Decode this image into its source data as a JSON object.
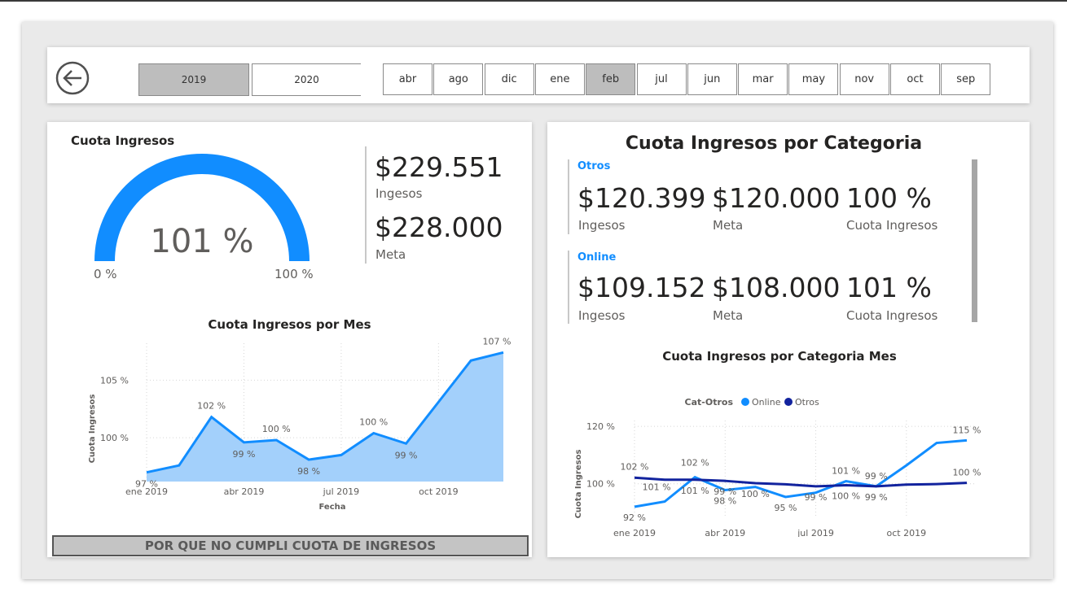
{
  "slicers": {
    "years": [
      {
        "label": "2019",
        "selected": true
      },
      {
        "label": "2020",
        "selected": false
      }
    ],
    "months": [
      {
        "label": "abr",
        "selected": false
      },
      {
        "label": "ago",
        "selected": false
      },
      {
        "label": "dic",
        "selected": false
      },
      {
        "label": "ene",
        "selected": false
      },
      {
        "label": "feb",
        "selected": true
      },
      {
        "label": "jul",
        "selected": false
      },
      {
        "label": "jun",
        "selected": false
      },
      {
        "label": "mar",
        "selected": false
      },
      {
        "label": "may",
        "selected": false
      },
      {
        "label": "nov",
        "selected": false
      },
      {
        "label": "oct",
        "selected": false
      },
      {
        "label": "sep",
        "selected": false
      }
    ]
  },
  "gauge": {
    "title": "Cuota Ingresos",
    "value_label": "101 %",
    "min_label": "0 %",
    "max_label": "100 %",
    "value": 101,
    "min": 0,
    "max": 100,
    "color": "#118dff"
  },
  "totals": {
    "ingresos_value": "$229.551",
    "ingresos_label": "Ingesos",
    "meta_value": "$228.000",
    "meta_label": "Meta"
  },
  "categories_card": {
    "title": "Cuota Ingresos por Categoria",
    "items": [
      {
        "name": "Otros",
        "ingresos": "$120.399",
        "ingresos_label": "Ingesos",
        "meta": "$120.000",
        "meta_label": "Meta",
        "cuota": "100 %",
        "cuota_label": "Cuota Ingresos"
      },
      {
        "name": "Online",
        "ingresos": "$109.152",
        "ingresos_label": "Ingesos",
        "meta": "$108.000",
        "meta_label": "Meta",
        "cuota": "101 %",
        "cuota_label": "Cuota Ingresos"
      }
    ]
  },
  "bottom_button": {
    "label": "POR QUE NO CUMPLI CUOTA DE INGRESOS"
  },
  "chart_data": [
    {
      "type": "area",
      "title": "Cuota Ingresos por Mes",
      "xlabel": "Fecha",
      "ylabel": "Cuota Ingresos",
      "x": [
        "2019-01",
        "2019-02",
        "2019-03",
        "2019-04",
        "2019-05",
        "2019-06",
        "2019-07",
        "2019-08",
        "2019-09",
        "2019-10",
        "2019-11",
        "2019-12"
      ],
      "x_ticks": [
        "ene 2019",
        "abr 2019",
        "jul 2019",
        "oct 2019"
      ],
      "y_ticks": [
        "100 %",
        "105 %"
      ],
      "ylim": [
        96.2,
        108.2
      ],
      "values": [
        97,
        97.6,
        101.8,
        99.6,
        99.8,
        98.1,
        98.5,
        100.4,
        99.5,
        103.1,
        106.7,
        107.4
      ],
      "data_labels": [
        {
          "i": 0,
          "text": "97 %"
        },
        {
          "i": 2,
          "text": "102 %"
        },
        {
          "i": 3,
          "text": "99 %"
        },
        {
          "i": 4,
          "text": "100 %"
        },
        {
          "i": 5,
          "text": "98 %"
        },
        {
          "i": 7,
          "text": "100 %"
        },
        {
          "i": 8,
          "text": "99 %"
        },
        {
          "i": 11,
          "text": "107 %"
        }
      ],
      "colors": {
        "line": "#118dff",
        "fill": "#a3d0fb"
      }
    },
    {
      "type": "line",
      "title": "Cuota Ingresos por Categoria Mes",
      "xlabel": "Fecha",
      "ylabel": "Cuota Ingresos",
      "legend_title": "Cat-Otros",
      "x": [
        "2019-01",
        "2019-02",
        "2019-03",
        "2019-04",
        "2019-05",
        "2019-06",
        "2019-07",
        "2019-08",
        "2019-09",
        "2019-10",
        "2019-11",
        "2019-12"
      ],
      "x_ticks": [
        "ene 2019",
        "abr 2019",
        "jul 2019",
        "oct 2019"
      ],
      "y_ticks": [
        "100 %",
        "120 %"
      ],
      "ylim": [
        88.6,
        122
      ],
      "series": [
        {
          "name": "Online",
          "color": "#118dff",
          "values": [
            92,
            93.8,
            102.3,
            97.8,
            98.9,
            95.4,
            96.9,
            100.9,
            99.1,
            106.4,
            114.2,
            115.1
          ],
          "labels": [
            {
              "i": 0,
              "text": "92 %"
            },
            {
              "i": 1,
              "text": "101 %"
            },
            {
              "i": 2,
              "text": "102 %"
            },
            {
              "i": 3,
              "text": "98 %"
            },
            {
              "i": 5,
              "text": "95 %"
            },
            {
              "i": 7,
              "text": "101 %"
            },
            {
              "i": 8,
              "text": "99 %"
            },
            {
              "i": 11,
              "text": "115 %"
            }
          ]
        },
        {
          "name": "Otros",
          "color": "#12239e",
          "values": [
            102.1,
            101.4,
            101.4,
            101,
            100.2,
            99.8,
            99.1,
            99.5,
            99.1,
            99.7,
            99.9,
            100.3
          ],
          "labels": [
            {
              "i": 0,
              "text": "102 %"
            },
            {
              "i": 2,
              "text": "101 %"
            },
            {
              "i": 3,
              "text": "99 %"
            },
            {
              "i": 4,
              "text": "100 %"
            },
            {
              "i": 6,
              "text": "99 %"
            },
            {
              "i": 7,
              "text": "100 %"
            },
            {
              "i": 8,
              "text": "99 %"
            },
            {
              "i": 11,
              "text": "100 %"
            }
          ]
        }
      ]
    }
  ]
}
